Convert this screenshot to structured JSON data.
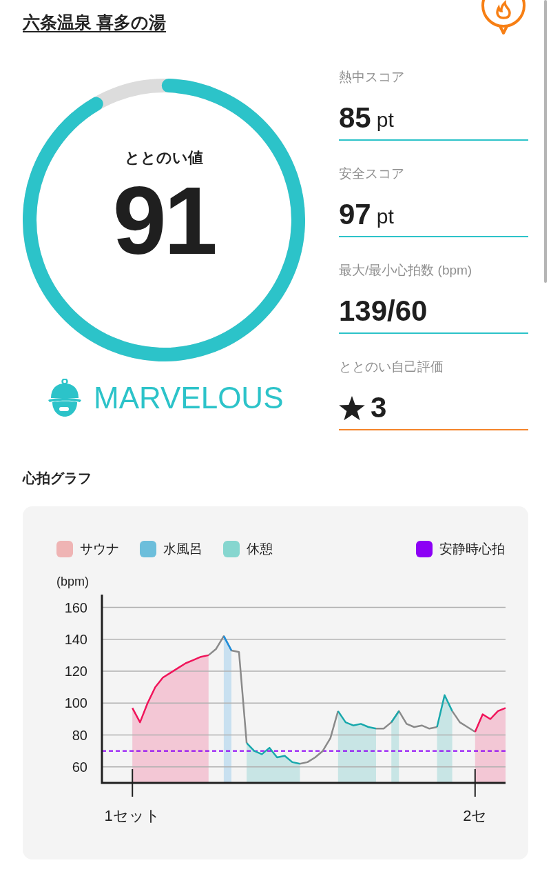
{
  "facility": {
    "name": "六条温泉 喜多の湯"
  },
  "gauge": {
    "label": "ととのい値",
    "value": "91",
    "grade": "MARVELOUS"
  },
  "stats": [
    {
      "kind": "score",
      "label": "熱中スコア",
      "value": "85",
      "unit": "pt"
    },
    {
      "kind": "score",
      "label": "安全スコア",
      "value": "97",
      "unit": "pt"
    },
    {
      "kind": "score",
      "label": "最大/最小心拍数 (bpm)",
      "value": "139/60"
    },
    {
      "kind": "rating",
      "label": "ととのい自己評価",
      "value": "3"
    }
  ],
  "heart_graph": {
    "title": "心拍グラフ",
    "legend": [
      {
        "label": "サウナ",
        "color": "#efb4b4"
      },
      {
        "label": "水風呂",
        "color": "#6cbedb"
      },
      {
        "label": "休憩",
        "color": "#86d6cf"
      },
      {
        "label": "安静時心拍",
        "color": "#8c00f5"
      }
    ],
    "chart_data": {
      "type": "area",
      "ylabel": "(bpm)",
      "ylim": [
        50,
        168
      ],
      "grid": true,
      "yticks": [
        60,
        80,
        100,
        120,
        140,
        160
      ],
      "categories": [
        null,
        null,
        null,
        null,
        "1セット",
        null,
        null,
        null,
        null,
        null,
        null,
        null,
        null,
        null,
        null,
        null,
        null,
        null,
        null,
        null,
        null,
        null,
        null,
        null,
        null,
        null,
        null,
        null,
        null,
        null,
        null,
        null,
        null,
        null,
        null,
        null,
        null,
        null,
        null,
        null,
        null,
        null,
        null,
        null,
        null,
        null,
        null,
        null,
        null,
        "2セ",
        null,
        null,
        null,
        null
      ],
      "series": [
        {
          "type": "line",
          "color": "#8a8a8a",
          "values": [
            null,
            null,
            null,
            null,
            null,
            null,
            null,
            null,
            null,
            null,
            null,
            null,
            null,
            null,
            130,
            134,
            142,
            133,
            132,
            75,
            null,
            null,
            null,
            null,
            null,
            null,
            62,
            63,
            66,
            70,
            78,
            95,
            null,
            null,
            null,
            null,
            84,
            84,
            88,
            95,
            87,
            85,
            86,
            84,
            85,
            null,
            95,
            88,
            85,
            82,
            null,
            null,
            null,
            null
          ]
        },
        {
          "color": "#f0145a",
          "values": [
            null,
            null,
            null,
            null,
            97,
            88,
            100,
            110,
            116,
            119,
            122,
            125,
            127,
            129,
            130,
            null,
            null,
            null,
            null,
            null,
            null,
            null,
            null,
            null,
            null,
            null,
            null,
            null,
            null,
            null,
            null,
            null,
            null,
            null,
            null,
            null,
            null,
            null,
            null,
            null,
            null,
            null,
            null,
            null,
            null,
            null,
            null,
            null,
            null,
            82,
            93,
            90,
            95,
            97
          ]
        },
        {
          "color": "#1a8fe0",
          "values": [
            null,
            null,
            null,
            null,
            null,
            null,
            null,
            null,
            null,
            null,
            null,
            null,
            null,
            null,
            null,
            null,
            142,
            133,
            null,
            null,
            null,
            null,
            null,
            null,
            null,
            null,
            null,
            null,
            null,
            null,
            null,
            null,
            null,
            null,
            null,
            null,
            null,
            null,
            null,
            null,
            null,
            null,
            null,
            null,
            null,
            null,
            null,
            null,
            null,
            null,
            null,
            null,
            null,
            null
          ]
        },
        {
          "color": "#18a8ac",
          "values": [
            null,
            null,
            null,
            null,
            null,
            null,
            null,
            null,
            null,
            null,
            null,
            null,
            null,
            null,
            null,
            null,
            null,
            null,
            null,
            75,
            70,
            68,
            72,
            66,
            67,
            63,
            62,
            null,
            null,
            null,
            null,
            95,
            88,
            86,
            87,
            85,
            84,
            null,
            88,
            95,
            null,
            null,
            null,
            null,
            85,
            105,
            95,
            null,
            null,
            null,
            null,
            null,
            null,
            null
          ]
        }
      ],
      "ref_lines": [
        {
          "axis": "y",
          "value": 70,
          "color": "#8c00f5"
        }
      ]
    }
  }
}
